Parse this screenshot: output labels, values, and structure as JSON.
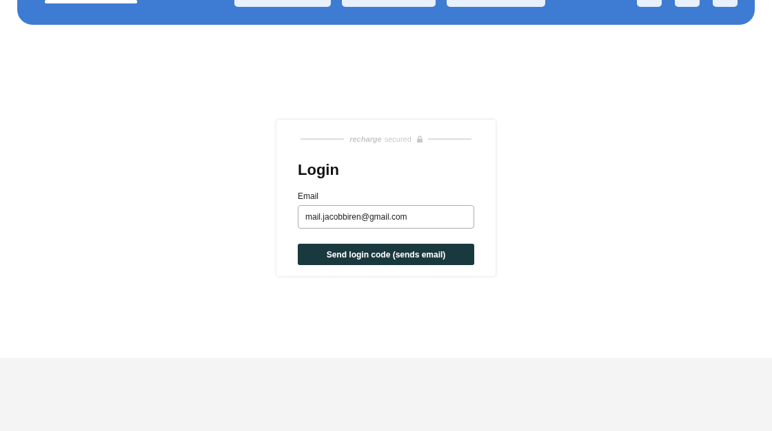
{
  "login_card": {
    "secured_badge": {
      "brand": "recharge",
      "text": "secured"
    },
    "title": "Login",
    "email_field": {
      "label": "Email",
      "value": "mail.jacobbiren@gmail.com"
    },
    "submit_button": "Send login code (sends email)"
  }
}
